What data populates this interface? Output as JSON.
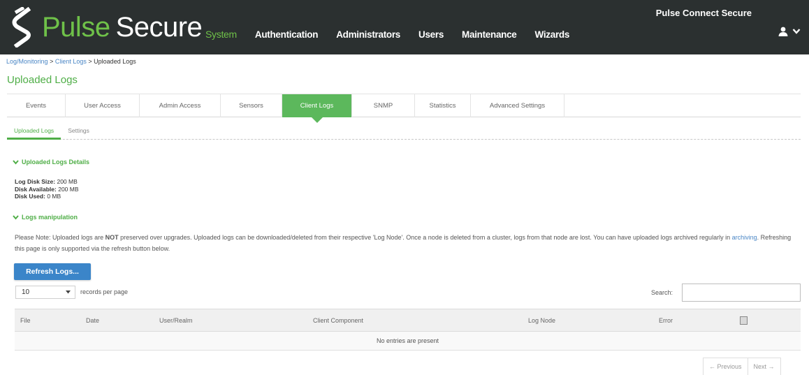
{
  "header": {
    "logo_icon": "pulse-s-icon",
    "logo_word1": "Pulse",
    "logo_word2": "Secure",
    "product_name": "Pulse Connect Secure",
    "nav": [
      {
        "label": "System",
        "active": true
      },
      {
        "label": "Authentication"
      },
      {
        "label": "Administrators"
      },
      {
        "label": "Users"
      },
      {
        "label": "Maintenance"
      },
      {
        "label": "Wizards"
      }
    ],
    "user_icon": "user-icon",
    "dropdown_icon": "chevron-down-icon",
    "colors": {
      "bar": "#2b3030",
      "accent": "#6fc149"
    }
  },
  "breadcrumb": {
    "item1": "Log/Monitoring",
    "sep": ">",
    "item2": "Client Logs",
    "current": "Uploaded Logs"
  },
  "page_title": "Uploaded Logs",
  "tabs": [
    {
      "label": "Events"
    },
    {
      "label": "User Access"
    },
    {
      "label": "Admin Access"
    },
    {
      "label": "Sensors"
    },
    {
      "label": "Client Logs",
      "active": true
    },
    {
      "label": "SNMP"
    },
    {
      "label": "Statistics"
    },
    {
      "label": "Advanced Settings"
    }
  ],
  "subtabs": [
    {
      "label": "Uploaded Logs",
      "active": true
    },
    {
      "label": "Settings"
    }
  ],
  "details_section": {
    "title": "Uploaded Logs Details",
    "disk_size_label": "Log Disk Size:",
    "disk_size_value": "200 MB",
    "disk_available_label": "Disk Available:",
    "disk_available_value": "200 MB",
    "disk_used_label": "Disk Used:",
    "disk_used_value": "0 MB"
  },
  "manipulation_section": {
    "title": "Logs manipulation",
    "note_prefix": "Please Note: Uploaded logs are ",
    "note_bold": "NOT",
    "note_mid": " preserved over upgrades. Uploaded logs can be downloaded/deleted from their respective 'Log Node'. Once a node is deleted from a cluster, logs from that node are lost. You can have uploaded logs archived regularly in ",
    "note_link": "archiving",
    "note_suffix": ". Refreshing this page is only supported via the refresh button below."
  },
  "refresh_button": "Refresh Logs...",
  "page_size": {
    "value": "10",
    "label": "records per page"
  },
  "search": {
    "label": "Search:",
    "value": ""
  },
  "table": {
    "columns": [
      "File",
      "Date",
      "User/Realm",
      "Client Component",
      "Log Node",
      "Error"
    ],
    "column_chooser_icon": "column-chooser-icon",
    "empty_message": "No entries are present"
  },
  "pager": {
    "previous": "← Previous",
    "next": "Next →"
  }
}
